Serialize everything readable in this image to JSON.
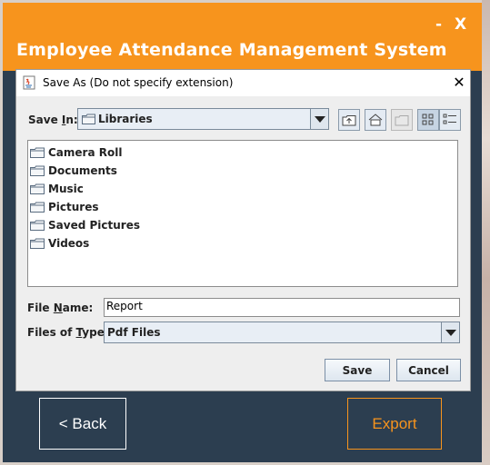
{
  "app": {
    "title": "Employee Attendance Management System",
    "minimize_label": "-",
    "close_label": "X",
    "back_label": "< Back",
    "export_label": "Export",
    "colors": {
      "header": "#f7941d",
      "body": "#2c3e50",
      "accent": "#f7941d"
    }
  },
  "dialog": {
    "title": "Save As (Do not specify extension)",
    "close_glyph": "✕",
    "save_in": {
      "label_prefix": "Save ",
      "label_mnemonic": "I",
      "label_suffix": "n:",
      "value": "Libraries"
    },
    "toolbar": {
      "buttons": [
        {
          "name": "up-one-level",
          "icon": "folder-up-icon"
        },
        {
          "name": "home",
          "icon": "home-icon"
        },
        {
          "name": "create-new-folder",
          "icon": "new-folder-icon",
          "enabled": false
        },
        {
          "name": "list-view",
          "icon": "list-view-icon",
          "selected": true
        },
        {
          "name": "details-view",
          "icon": "details-view-icon"
        }
      ]
    },
    "files": [
      "Camera Roll",
      "Documents",
      "Music",
      "Pictures",
      "Saved Pictures",
      "Videos"
    ],
    "file_name": {
      "label_prefix": "File ",
      "label_mnemonic": "N",
      "label_suffix": "ame:",
      "value": "Report"
    },
    "file_type": {
      "label_prefix": "Files of ",
      "label_mnemonic": "T",
      "label_suffix": "ype:",
      "value": "Pdf Files"
    },
    "save_label": "Save",
    "cancel_label": "Cancel"
  }
}
